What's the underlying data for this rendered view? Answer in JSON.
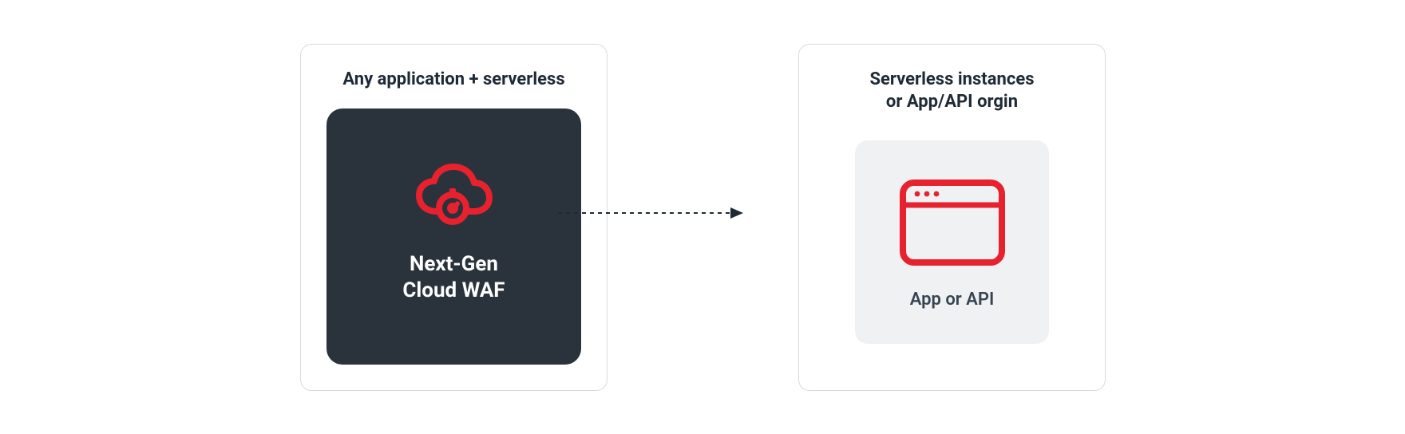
{
  "colors": {
    "accent": "#e8212e",
    "darkCard": "#2a323b",
    "lightCard": "#eff1f3",
    "border": "#d6dbe1",
    "text": "#1f2a36"
  },
  "leftPanel": {
    "title": "Any application + serverless",
    "card": {
      "icon": "cloud-waf-icon",
      "label_line1": "Next-Gen",
      "label_line2": "Cloud WAF"
    }
  },
  "rightPanel": {
    "title_line1": "Serverless instances",
    "title_line2": "or App/API orgin",
    "card": {
      "icon": "app-window-icon",
      "label": "App or API"
    }
  },
  "arrow": {
    "style": "dashed",
    "direction": "right"
  }
}
